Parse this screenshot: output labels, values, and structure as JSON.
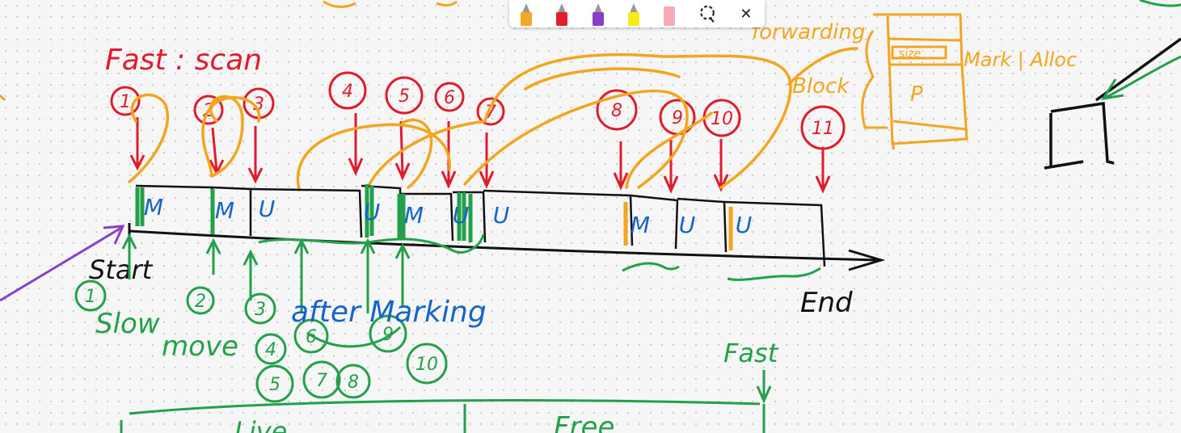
{
  "toolbar": {
    "pens": [
      {
        "name": "pencil",
        "color": "#f5a623"
      },
      {
        "name": "red-pen",
        "color": "#e0202e"
      },
      {
        "name": "purple-pen",
        "color": "#8a3fc8"
      },
      {
        "name": "yellow-highlighter",
        "color": "#f7ec1a"
      },
      {
        "name": "eraser",
        "color": "#f7a9b5"
      }
    ],
    "lasso_icon": "lasso-icon",
    "close_icon": "close-icon"
  },
  "labels": {
    "fast_scan": "Fast : scan",
    "forwarding": "forwarding",
    "block": "Block",
    "size": "size",
    "mark_alloc": "Mark | Alloc",
    "p": "P",
    "start": "Start",
    "end": "End",
    "slow": "Slow",
    "move": "move",
    "after_marking": "after Marking",
    "fast_bottom": "Fast",
    "live": "Live",
    "free": "Free"
  },
  "red_numbers": [
    "1",
    "2",
    "3",
    "4",
    "5",
    "6",
    "7",
    "8",
    "9",
    "10",
    "11"
  ],
  "green_numbers": [
    "1",
    "2",
    "3",
    "4",
    "5",
    "6",
    "7",
    "8",
    "9",
    "10"
  ],
  "block_marks": [
    "M",
    "M",
    "U",
    "U",
    "M",
    "U",
    "U",
    "M",
    "U",
    "U"
  ],
  "colors": {
    "red": "#e01b2c",
    "green": "#22a04a",
    "blue": "#1565c8",
    "orange": "#f3a51f",
    "purple": "#8a3fc8",
    "black": "#111111"
  }
}
